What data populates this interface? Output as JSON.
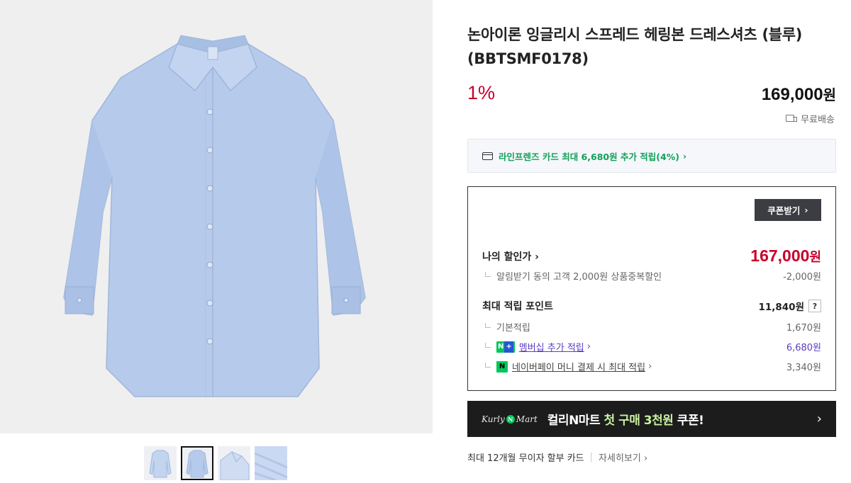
{
  "product": {
    "title": "논아이론 잉글리시 스프레드 헤링본 드레스셔츠 (블루) (BBTSMF0178)",
    "discount_rate": "1%",
    "price": "169,000",
    "price_unit": "원",
    "shipping": "무료배송"
  },
  "card_banner": {
    "text": "라인프렌즈 카드 최대 6,680원 추가 적립(4%)",
    "arrow": "›"
  },
  "benefits": {
    "coupon_button": "쿠폰받기",
    "coupon_arrow": "›",
    "my_price_label": "나의 할인가",
    "my_price_arrow": "›",
    "my_price_value": "167,000",
    "my_price_unit": "원",
    "alarm_label": "알림받기 동의 고객 2,000원 상품중복할인",
    "alarm_value": "-2,000원",
    "max_points_label": "최대 적립 포인트",
    "max_points_value": "11,840원",
    "help": "?",
    "basic_label": "기본적립",
    "basic_value": "1,670원",
    "membership_badge_n": "N",
    "membership_badge_plus": "+",
    "membership_label": "멤버십 추가 적립",
    "membership_arrow": "›",
    "membership_value": "6,680원",
    "pay_badge": "N",
    "pay_label": "네이버페이 머니 결제 시 최대 적립",
    "pay_arrow": "›",
    "pay_value": "3,340원"
  },
  "kurly_banner": {
    "logo_left": "Kurly",
    "logo_n": "N",
    "logo_right": "Mart",
    "text_main": "컬리N마트 ",
    "text_highlight": "첫 구매 3천원",
    "text_end": " 쿠폰!",
    "arrow": "›"
  },
  "installment": {
    "text": "최대 12개월 무이자 할부 카드",
    "more": "자세히보기 ›"
  },
  "colors": {
    "discount_red": "#c9002b",
    "naver_green": "#03c75a",
    "membership_purple": "#5b3cc4",
    "shirt_blue": "#b6cbec"
  }
}
